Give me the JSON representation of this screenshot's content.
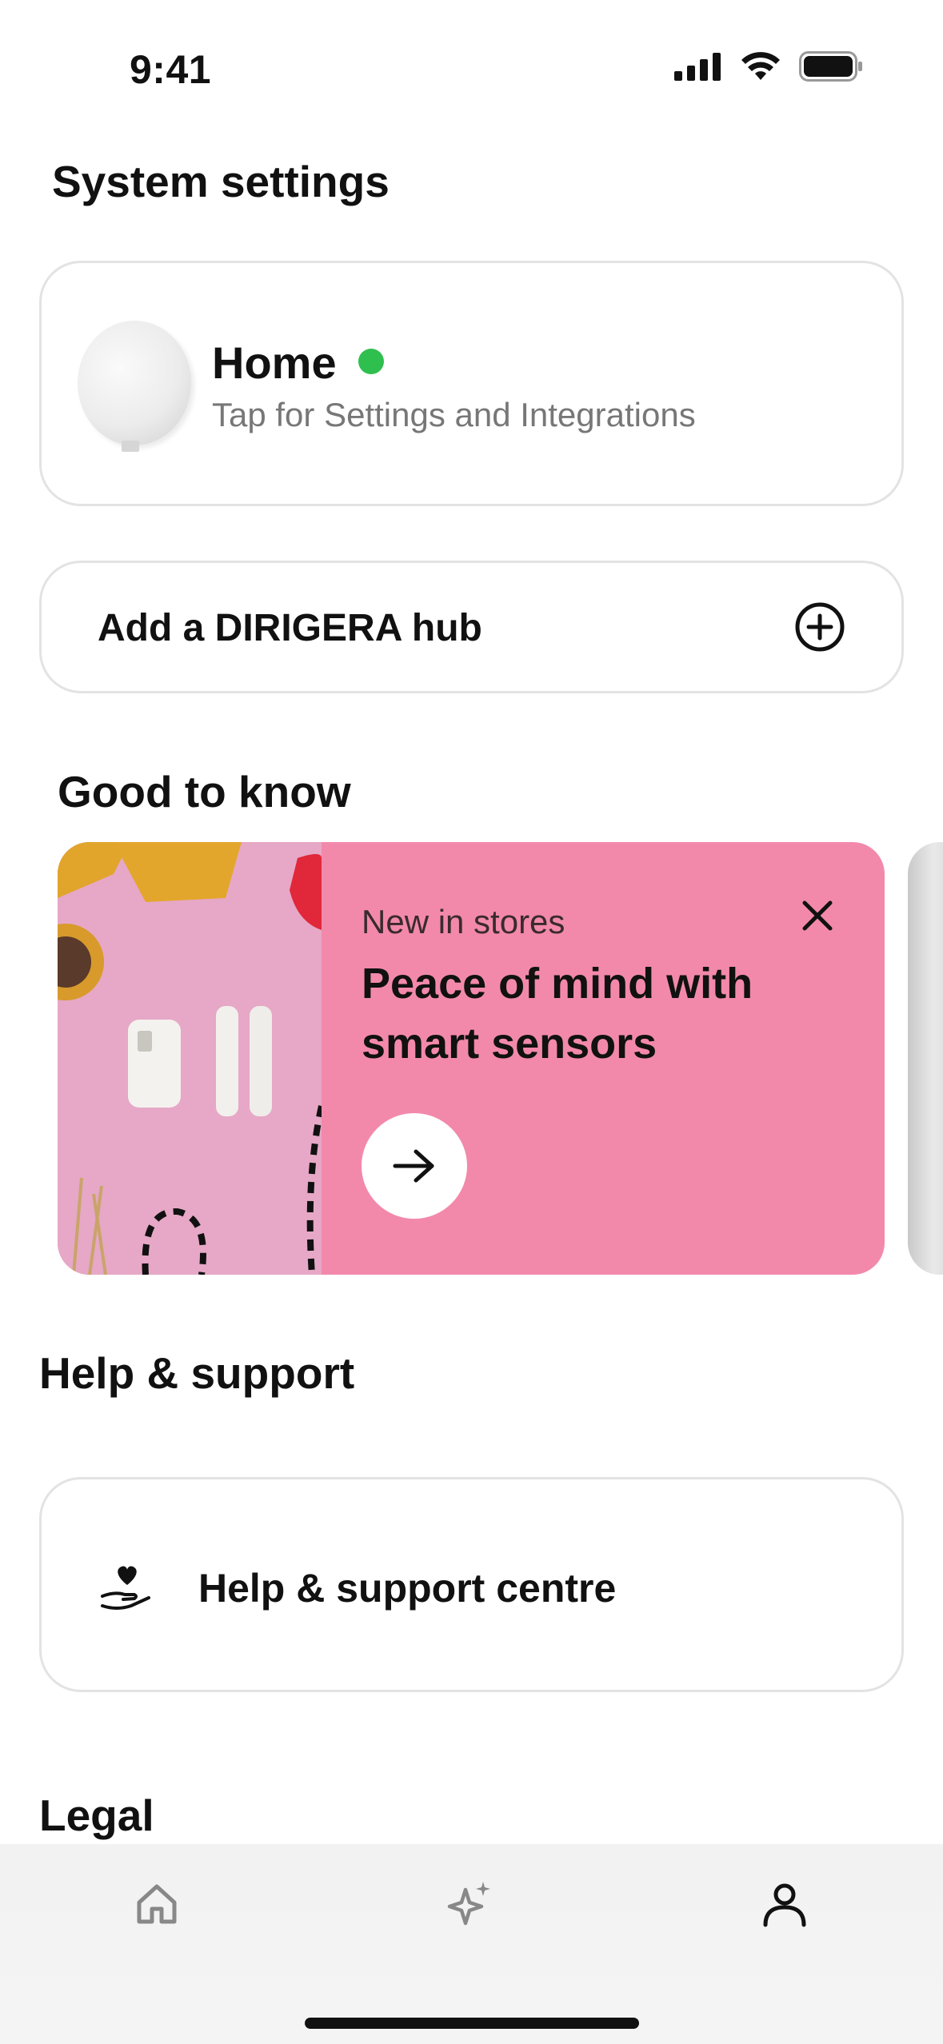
{
  "status_bar": {
    "time": "9:41"
  },
  "page_title": "System settings",
  "hub_card": {
    "name": "Home",
    "status_color": "#2fbf4f",
    "subtitle": "Tap for Settings and Integrations"
  },
  "add_hub": {
    "label": "Add a DIRIGERA hub",
    "icon": "plus-circle-icon"
  },
  "good_to_know": {
    "title": "Good to know",
    "promo": {
      "kicker": "New in stores",
      "headline": "Peace of mind with smart sensors",
      "background": "#f289ab",
      "close_icon": "close-icon",
      "action_icon": "arrow-right-icon"
    }
  },
  "help_support": {
    "title": "Help & support",
    "item_label": "Help & support centre",
    "item_icon": "heart-hand-icon"
  },
  "legal": {
    "title": "Legal"
  },
  "tab_bar": {
    "tabs": [
      {
        "icon": "home-icon",
        "active": false
      },
      {
        "icon": "sparkle-icon",
        "active": false
      },
      {
        "icon": "person-icon",
        "active": true
      }
    ]
  }
}
